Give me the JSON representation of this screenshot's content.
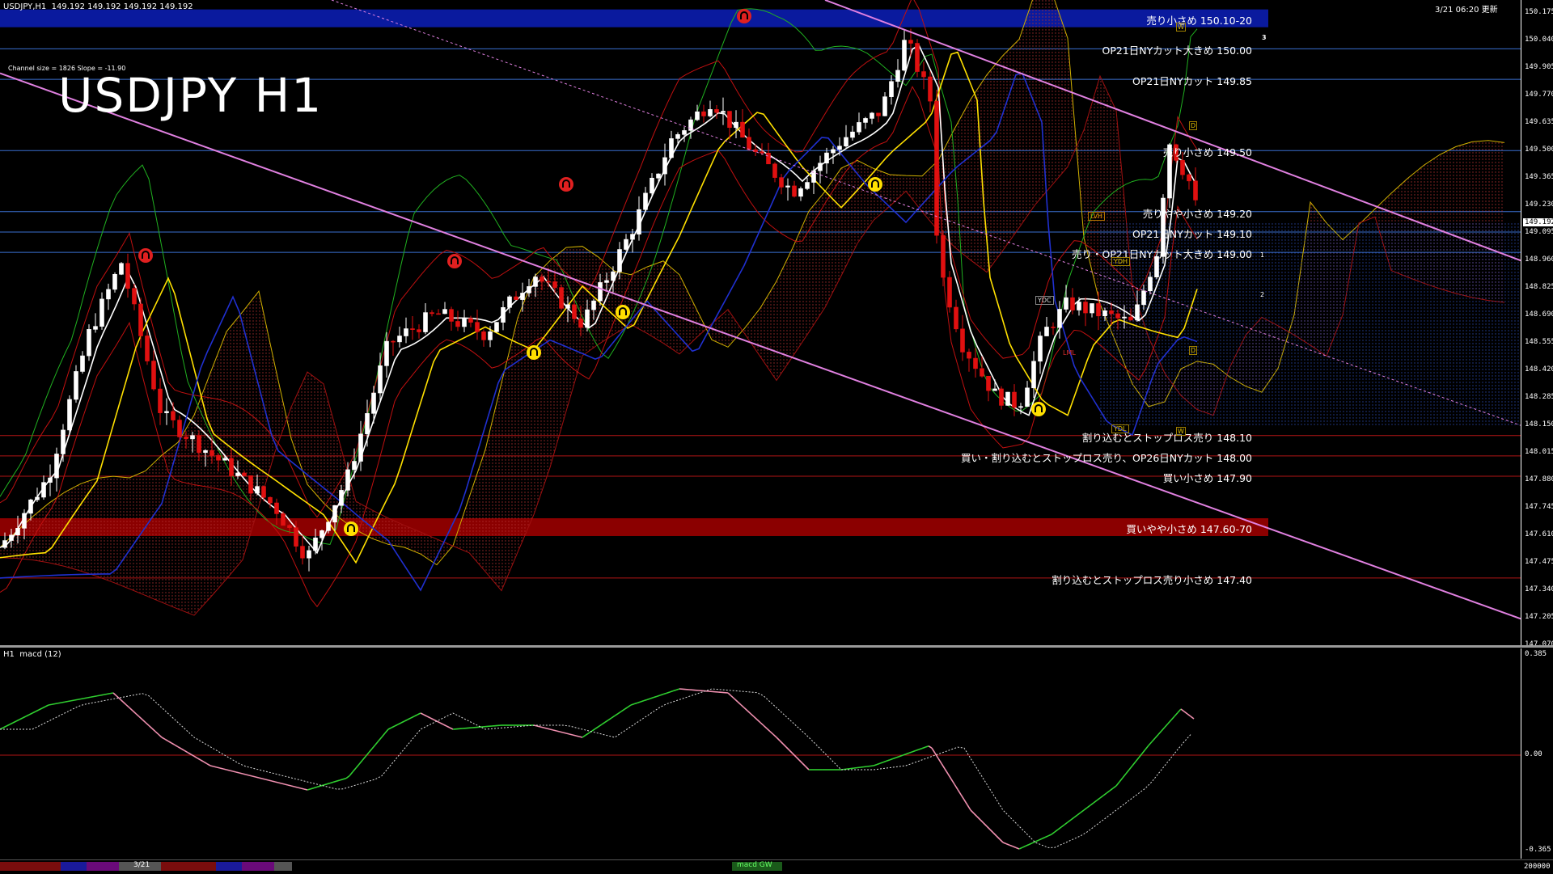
{
  "header": {
    "symbol_info": "USDJPY,H1  149.192 149.192 149.192 149.192",
    "timestamp": "3/21 06:20 更新",
    "channel_info": "Channel size = 1826 Slope = -11.90",
    "chart_title": "USDJPY H1"
  },
  "current_price": "149.192",
  "price_axis": [
    "150.175",
    "150.040",
    "149.905",
    "149.770",
    "149.635",
    "149.500",
    "149.365",
    "149.230",
    "149.095",
    "148.960",
    "148.825",
    "148.690",
    "148.555",
    "148.420",
    "148.285",
    "148.150",
    "148.015",
    "147.880",
    "147.745",
    "147.610",
    "147.475",
    "147.340",
    "147.205",
    "147.070"
  ],
  "price_range": [
    147.07,
    150.24
  ],
  "levels": [
    {
      "price": 150.15,
      "label": "売り小さめ 150.10-20",
      "band": true,
      "color": "#0a1a9e"
    },
    {
      "price": 150.0,
      "label": "OP21日NYカット大きめ 150.00",
      "color": "#3a6fd0"
    },
    {
      "price": 149.85,
      "label": "OP21日NYカット 149.85",
      "color": "#3a6fd0"
    },
    {
      "price": 149.5,
      "label": "売り小さめ 149.50",
      "color": "#3a6fd0"
    },
    {
      "price": 149.2,
      "label": "売りやや小さめ 149.20",
      "color": "#3a6fd0"
    },
    {
      "price": 149.1,
      "label": "OP21日NYカット 149.10",
      "color": "#3a6fd0"
    },
    {
      "price": 149.0,
      "label": "売り・OP21日NYカット大きめ 149.00",
      "color": "#3a6fd0"
    },
    {
      "price": 148.1,
      "label": "割り込むとストップロス売り 148.10",
      "color": "#b01515"
    },
    {
      "price": 148.0,
      "label": "買い・割り込むとストップロス売り、OP26日NYカット 148.00",
      "color": "#b01515"
    },
    {
      "price": 147.9,
      "label": "買い小さめ 147.90",
      "color": "#b01515"
    },
    {
      "price": 147.65,
      "label": "買いやや小さめ 147.60-70",
      "band": true,
      "color": "#8b0000"
    },
    {
      "price": 147.4,
      "label": "割り込むとストップロス売り小さめ 147.40",
      "color": "#b01515"
    }
  ],
  "markers": {
    "lvh": "LVH",
    "ydh": "YDH",
    "ydc": "YDC",
    "lml": "LML",
    "ydl": "YDL",
    "w": "W",
    "d": "D",
    "num1": "1",
    "num2": "2",
    "num3": "3"
  },
  "macd": {
    "title": "H1  macd (12)",
    "axis_top": "0.385",
    "axis_zero": "0.00",
    "axis_bottom": "-0.365",
    "axis_extra": "200000"
  },
  "tabs": {
    "date_tab": "3/21",
    "macd_tab": "macd GW"
  },
  "colors": {
    "bg": "#000000",
    "bull_candle": "#ffffff",
    "bear_candle": "#e01010",
    "ma_short": "#ffffff",
    "ma_mid": "#ffe000",
    "ma_long": "#2030d0",
    "channel": "#e080e0",
    "macd_up": "#30d030",
    "macd_down": "#f090b0"
  }
}
